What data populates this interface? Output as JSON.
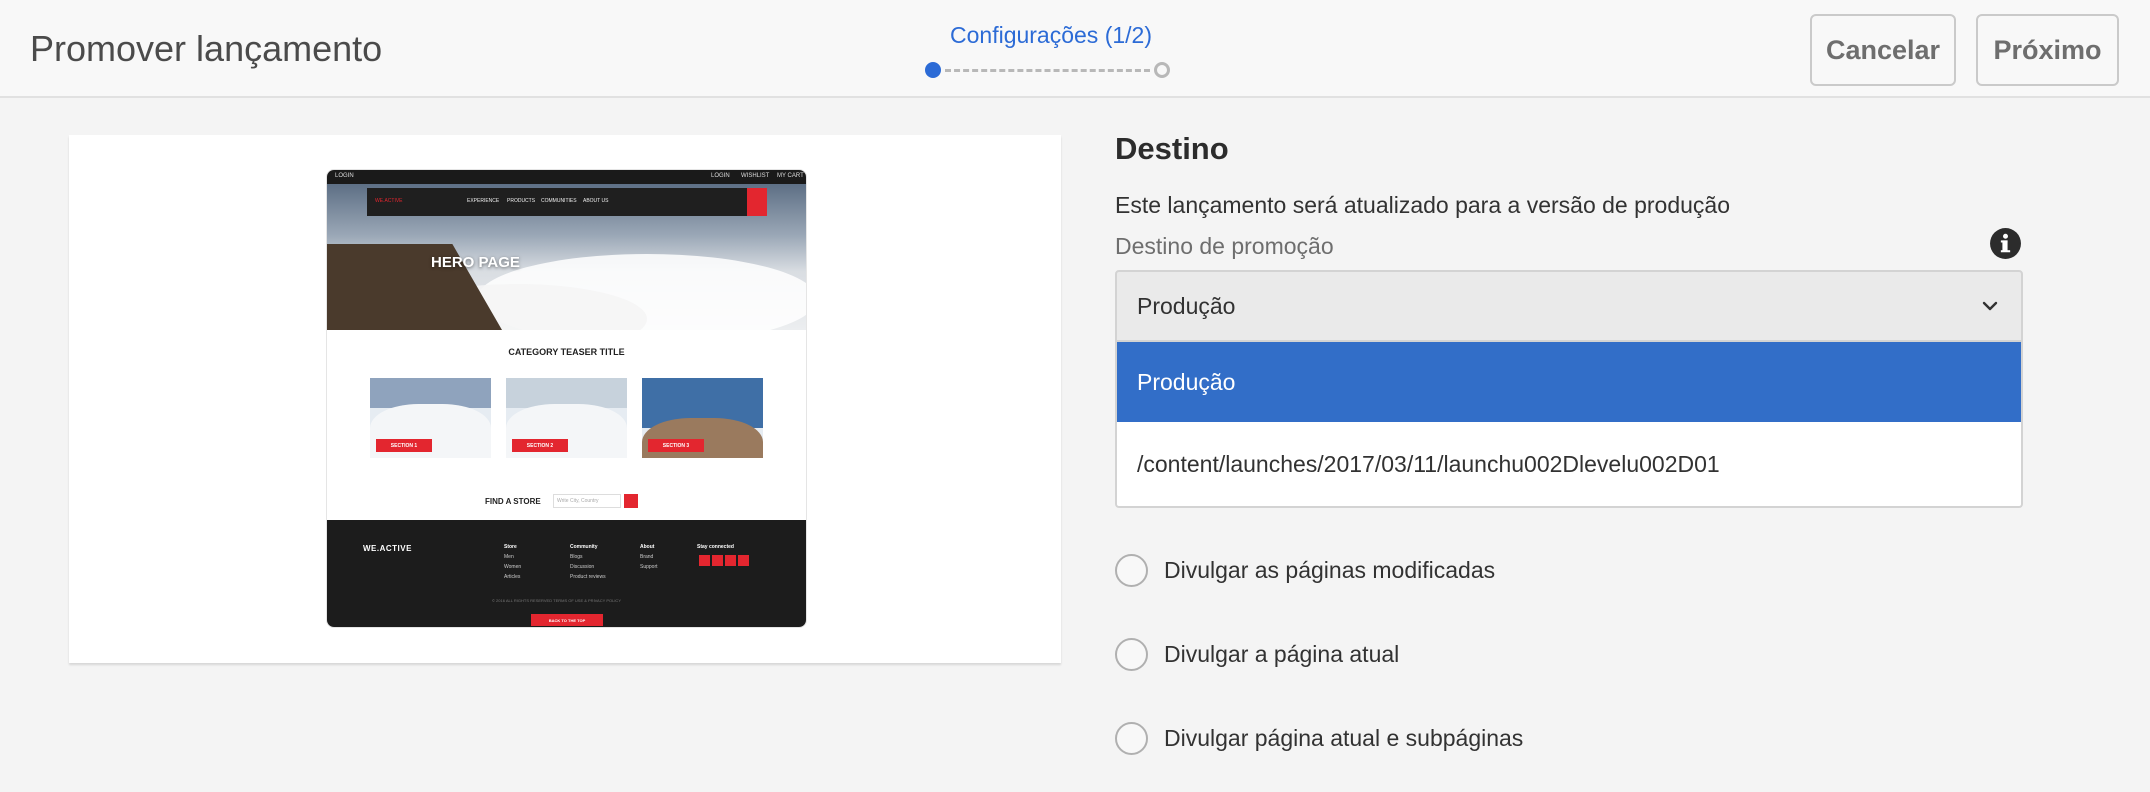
{
  "header": {
    "title": "Promover lançamento",
    "step_label": "Configurações (1/2)",
    "cancel_label": "Cancelar",
    "next_label": "Próximo"
  },
  "preview": {
    "topbar": {
      "left": "LOGIN",
      "links": [
        "LOGIN",
        "WISHLIST",
        "MY CART"
      ]
    },
    "nav": {
      "brand": "WE.ACTIVE",
      "items": [
        "EXPERIENCE",
        "PRODUCTS",
        "COMMUNITIES",
        "ABOUT US"
      ]
    },
    "hero_title": "HERO PAGE",
    "teaser_title": "CATEGORY TEASER TITLE",
    "teasers": [
      "SECTION 1",
      "SECTION 2",
      "SECTION 3"
    ],
    "store_label": "FIND A STORE",
    "store_placeholder": "Write City, Country",
    "footer": {
      "brand": "WE.ACTIVE",
      "columns": [
        {
          "heading": "Store",
          "items": [
            "Men",
            "Women",
            "Articles"
          ]
        },
        {
          "heading": "Community",
          "items": [
            "Blogs",
            "Discussion",
            "Product reviews"
          ]
        },
        {
          "heading": "About",
          "items": [
            "Brand",
            "Support"
          ]
        },
        {
          "heading": "Stay connected",
          "items": []
        }
      ],
      "copyright": "© 2016 ALL RIGHTS RESERVED      TERMS OF USE & PRIVACY POLICY",
      "back_to_top": "BACK TO THE TOP"
    }
  },
  "form": {
    "section_title": "Destino",
    "description": "Este lançamento será atualizado para a versão de produção",
    "field_label": "Destino de promoção",
    "select_value": "Produção",
    "options": [
      "Produção",
      "/content/launches/2017/03/11/launchu002Dlevelu002D01"
    ],
    "radios": [
      "Divulgar as páginas modificadas",
      "Divulgar a página atual",
      "Divulgar página atual e subpáginas"
    ]
  },
  "colors": {
    "accent": "#326ec8",
    "step_blue": "#2c6bd6",
    "brand_red": "#e3262f"
  }
}
